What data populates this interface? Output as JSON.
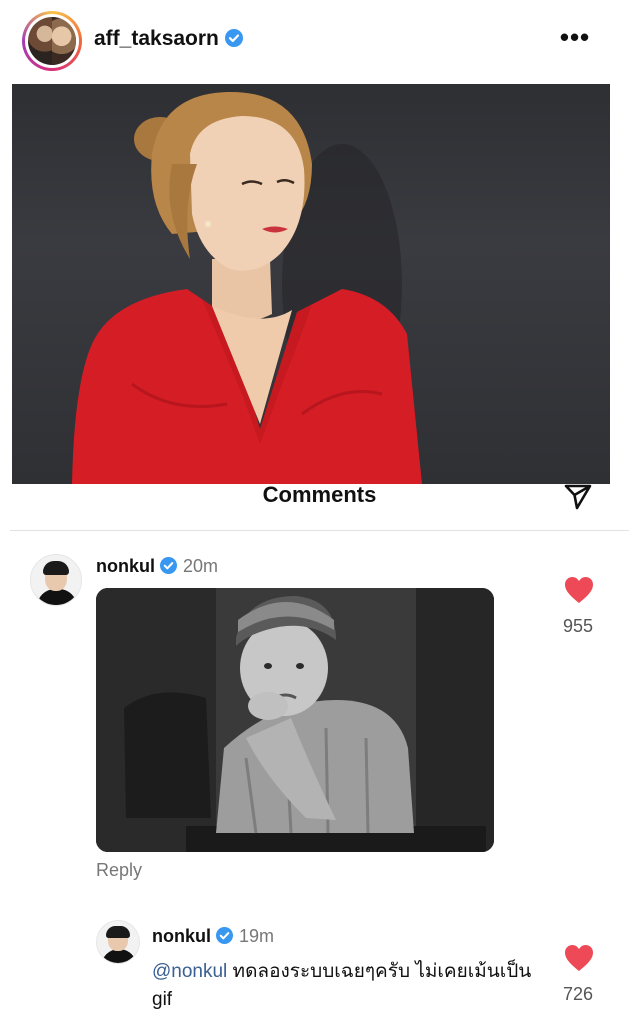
{
  "post": {
    "username": "aff_taksaorn",
    "verified": true,
    "more_icon": "more-horizontal-icon",
    "photo": "woman-in-red-dress-portrait"
  },
  "comments_sheet": {
    "title": "Comments",
    "send_icon": "paper-plane-icon",
    "comments": [
      {
        "username": "nonkul",
        "verified": true,
        "time": "20m",
        "gif": "sulking-boy-black-and-white",
        "reply_label": "Reply",
        "likes": "955"
      },
      {
        "username": "nonkul",
        "verified": true,
        "time": "19m",
        "mention": "@nonkul",
        "text": " ทดลองระบบเฉยๆครับ ไม่เคยเม้นเป็น gif",
        "likes": "726"
      }
    ]
  },
  "colors": {
    "verified": "#3897f0",
    "heart": "#ed4956",
    "mention": "#3a5f93"
  }
}
